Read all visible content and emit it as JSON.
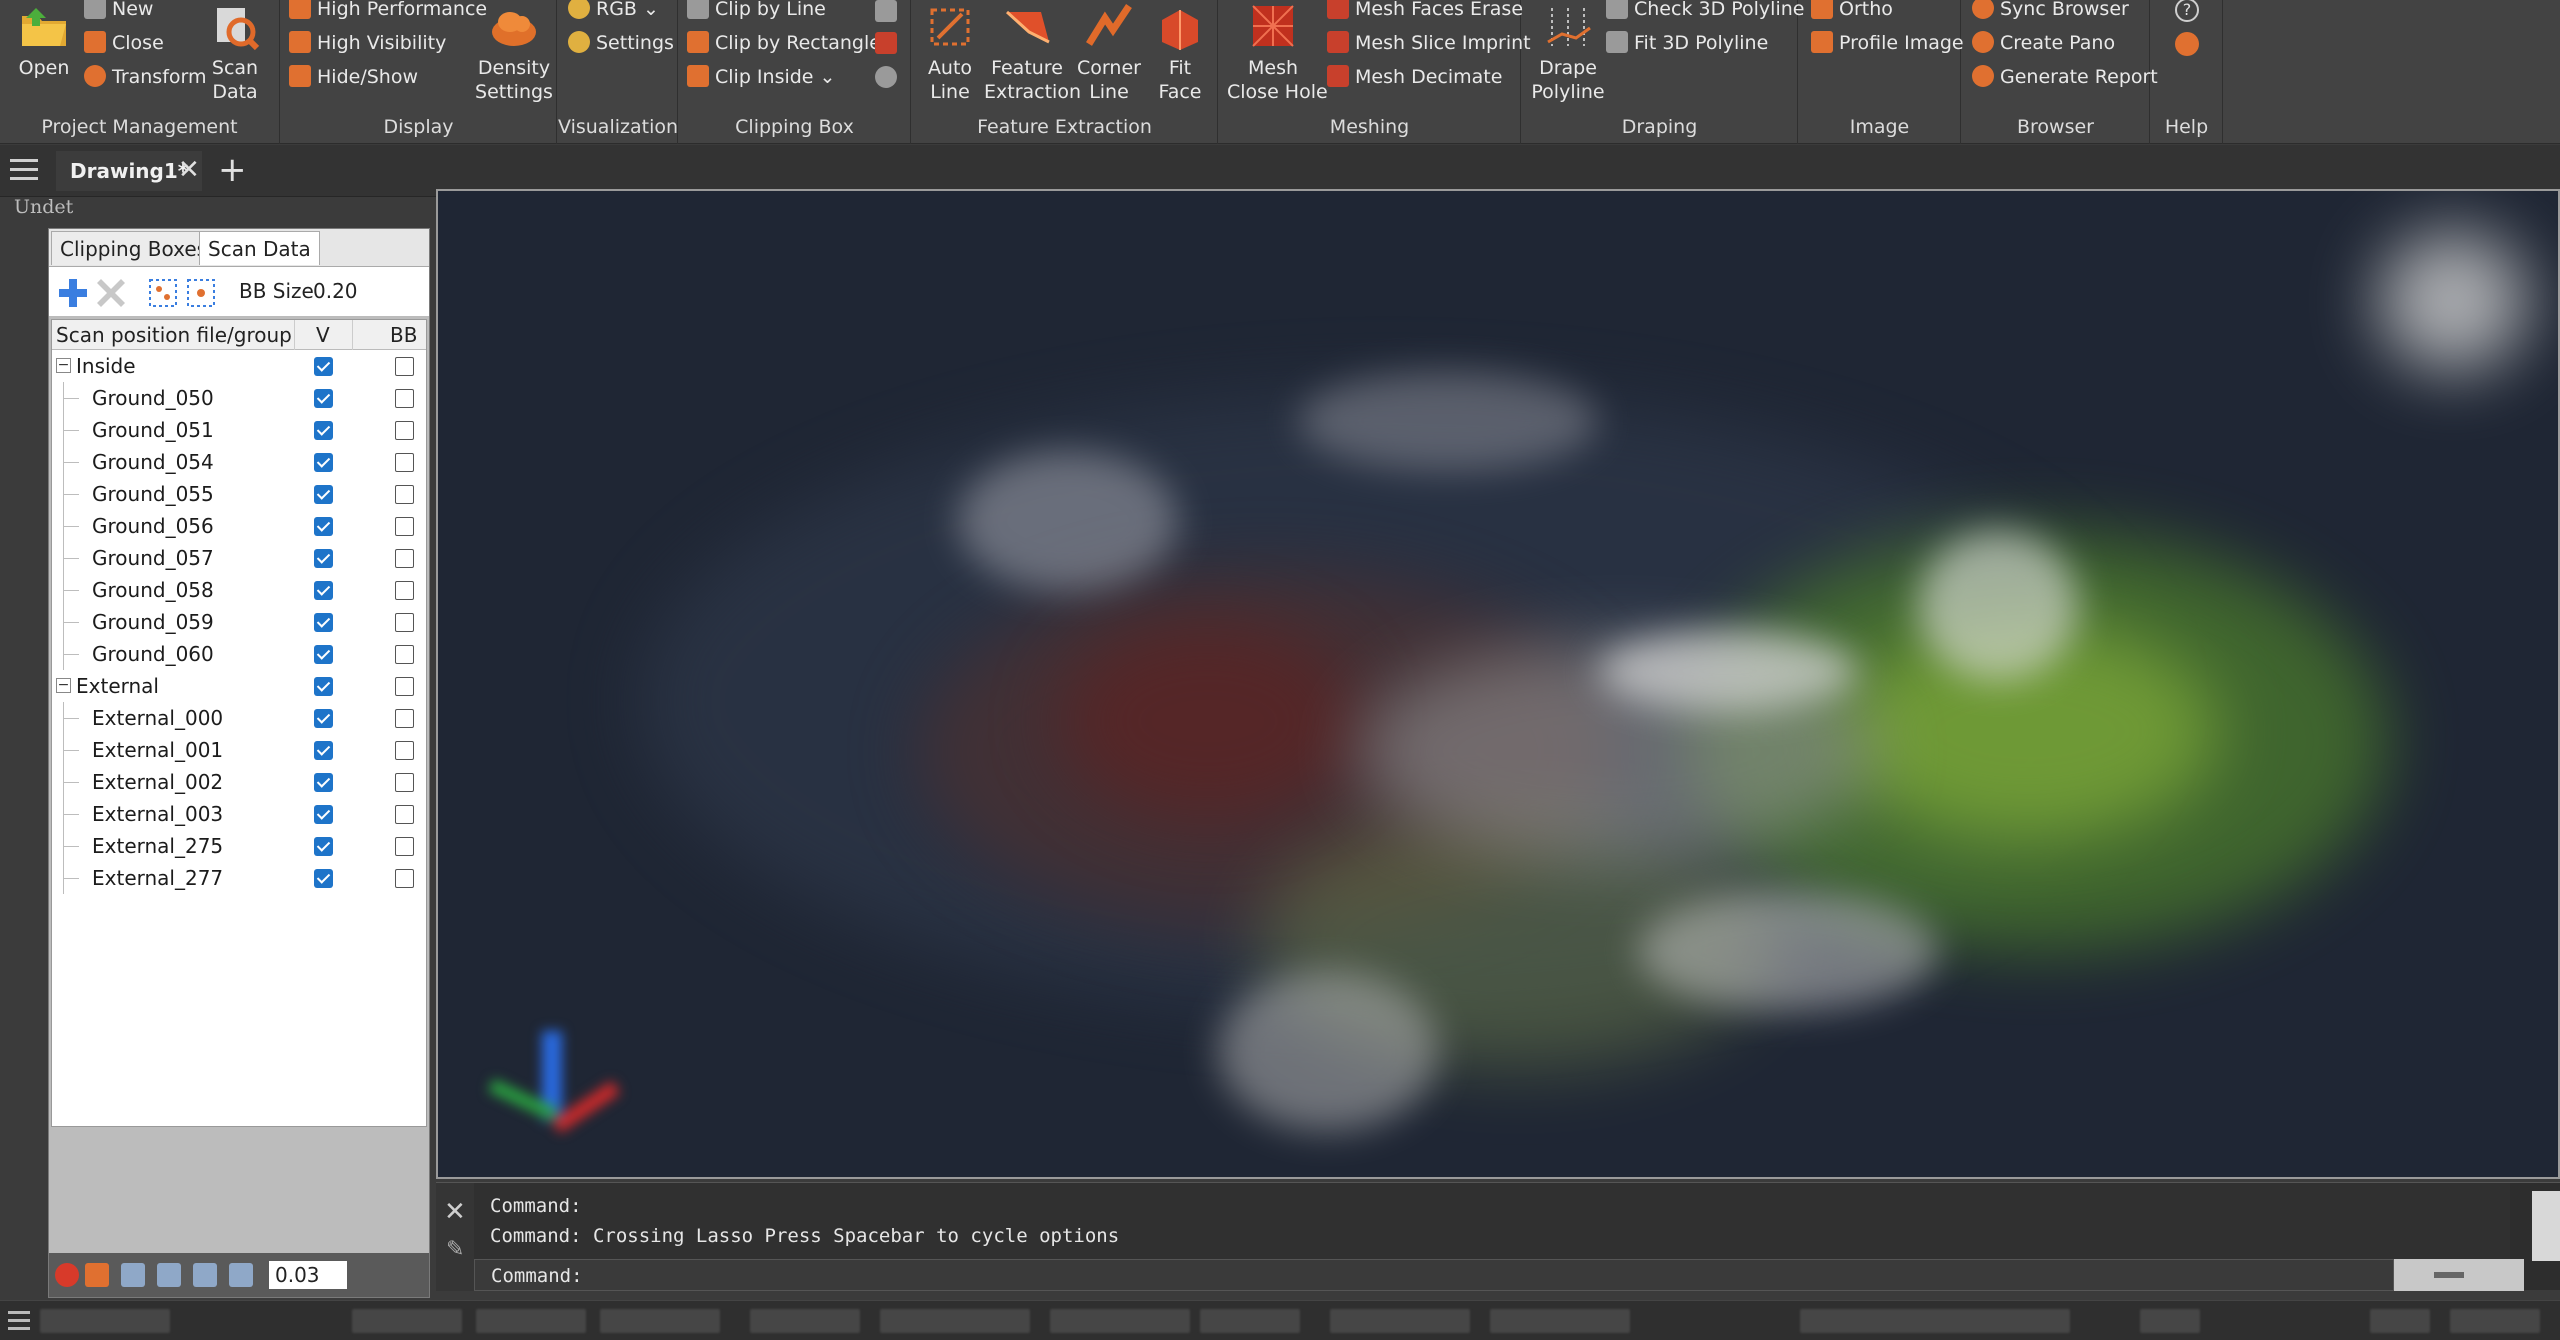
{
  "ribbon": {
    "project_management": {
      "label": "Project Management",
      "open": "Open",
      "new": "New",
      "close": "Close",
      "transform": "Transform",
      "scan_data_1": "Scan",
      "scan_data_2": "Data"
    },
    "display": {
      "label": "Display",
      "high_performance": "High Performance",
      "high_visibility": "High Visibility",
      "hide_show": "Hide/Show",
      "density_1": "Density",
      "density_2": "Settings"
    },
    "visualization": {
      "label": "Visualization",
      "rgb": "RGB",
      "settings": "Settings"
    },
    "clipping_box": {
      "label": "Clipping Box",
      "clip_by_line": "Clip by Line",
      "clip_by_rectangle": "Clip by Rectangle",
      "clip_inside": "Clip Inside"
    },
    "feature_extraction": {
      "label": "Feature Extraction",
      "auto_line_1": "Auto",
      "auto_line_2": "Line",
      "feature_extraction_1": "Feature",
      "feature_extraction_2": "Extraction",
      "corner_line_1": "Corner",
      "corner_line_2": "Line",
      "fit_face_1": "Fit",
      "fit_face_2": "Face"
    },
    "meshing": {
      "label": "Meshing",
      "mesh_close_hole_1": "Mesh",
      "mesh_close_hole_2": "Close Hole",
      "mesh_faces_erase": "Mesh Faces Erase",
      "mesh_slice_imprint": "Mesh Slice Imprint",
      "mesh_decimate": "Mesh Decimate"
    },
    "draping": {
      "label": "Draping",
      "drape_polyline_1": "Drape",
      "drape_polyline_2": "Polyline",
      "check_3d_polyline": "Check 3D Polyline",
      "fit_3d_polyline": "Fit 3D Polyline"
    },
    "image": {
      "label": "Image",
      "ortho": "Ortho",
      "profile_image": "Profile Image"
    },
    "browser": {
      "label": "Browser",
      "sync_browser": "Sync Browser",
      "create_pano": "Create Pano",
      "generate_report": "Generate Report"
    },
    "help": {
      "label": "Help"
    }
  },
  "doc_tab": {
    "title": "Drawing1*"
  },
  "undet_label": "Undet",
  "panel": {
    "tabs": [
      "Clipping Boxes",
      "Scan Data"
    ],
    "bb_size_label": "BB Size",
    "bb_size_value": "0.20",
    "columns": [
      "Scan position file/group",
      "V",
      "BB"
    ],
    "groups": [
      {
        "name": "Inside",
        "items": [
          "Ground_050",
          "Ground_051",
          "Ground_054",
          "Ground_055",
          "Ground_056",
          "Ground_057",
          "Ground_058",
          "Ground_059",
          "Ground_060"
        ]
      },
      {
        "name": "External",
        "items": [
          "External_000",
          "External_001",
          "External_002",
          "External_003",
          "External_275",
          "External_277"
        ]
      }
    ],
    "point_size_value": "0.03"
  },
  "command": {
    "lines": [
      "Command:",
      "Command: Crossing Lasso  Press Spacebar to cycle options"
    ],
    "prompt": "Command:"
  },
  "colors": {
    "ribbon_bg": "#434343",
    "checkbox_blue": "#1e74c9",
    "viewport_bg": "#1f2634"
  }
}
